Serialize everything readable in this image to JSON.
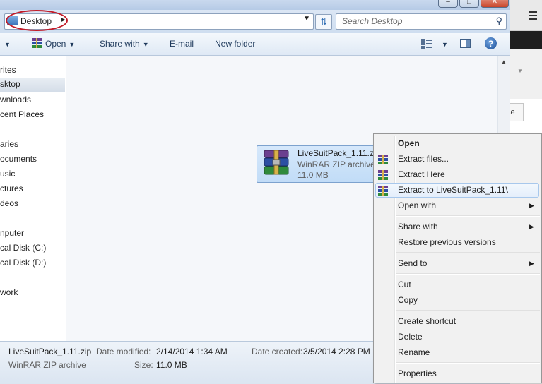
{
  "window": {
    "caption_buttons": [
      "minimize",
      "maximize",
      "close"
    ]
  },
  "address": {
    "location": "Desktop",
    "search_placeholder": "Search Desktop"
  },
  "toolbar": {
    "open": "Open",
    "share_with": "Share with",
    "email": "E-mail",
    "new_folder": "New folder"
  },
  "nav": {
    "items": [
      {
        "label": "rites"
      },
      {
        "label": "sktop",
        "selected": true
      },
      {
        "label": "wnloads"
      },
      {
        "label": "cent Places"
      },
      {
        "label": "aries"
      },
      {
        "label": "ocuments"
      },
      {
        "label": "usic"
      },
      {
        "label": "ctures"
      },
      {
        "label": "deos"
      },
      {
        "label": "nputer"
      },
      {
        "label": "cal Disk (C:)"
      },
      {
        "label": "cal Disk (D:)"
      },
      {
        "label": "work"
      }
    ]
  },
  "file": {
    "name": "LiveSuitPack_1.11.zip",
    "type": "WinRAR ZIP archive",
    "size": "11.0 MB",
    "icon": "winrar-archive-icon"
  },
  "details": {
    "name": "LiveSuitPack_1.11.zip",
    "type": "WinRAR ZIP archive",
    "modified_label": "Date modified:",
    "modified_value": "2/14/2014 1:34 AM",
    "size_label": "Size:",
    "size_value": "11.0 MB",
    "created_label": "Date created:",
    "created_value": "3/5/2014 2:28 PM"
  },
  "background_app": {
    "button_text": "se"
  },
  "context_menu": {
    "items": [
      {
        "label": "Open",
        "bold": true
      },
      {
        "label": "Extract files...",
        "icon": "winrar-icon"
      },
      {
        "label": "Extract Here",
        "icon": "winrar-icon"
      },
      {
        "label": "Extract to LiveSuitPack_1.11\\",
        "icon": "winrar-icon",
        "highlighted": true
      },
      {
        "label": "Open with",
        "submenu": true
      },
      {
        "label": "Share with",
        "submenu": true
      },
      {
        "label": "Restore previous versions"
      },
      {
        "label": "Send to",
        "submenu": true
      },
      {
        "label": "Cut"
      },
      {
        "label": "Copy"
      },
      {
        "label": "Create shortcut"
      },
      {
        "label": "Delete"
      },
      {
        "label": "Rename"
      },
      {
        "label": "Properties"
      }
    ]
  },
  "colors": {
    "annotation_circle": "#c21b28",
    "selection": "#c1dcf7",
    "menu_highlight_border": "#a8c8ec"
  }
}
